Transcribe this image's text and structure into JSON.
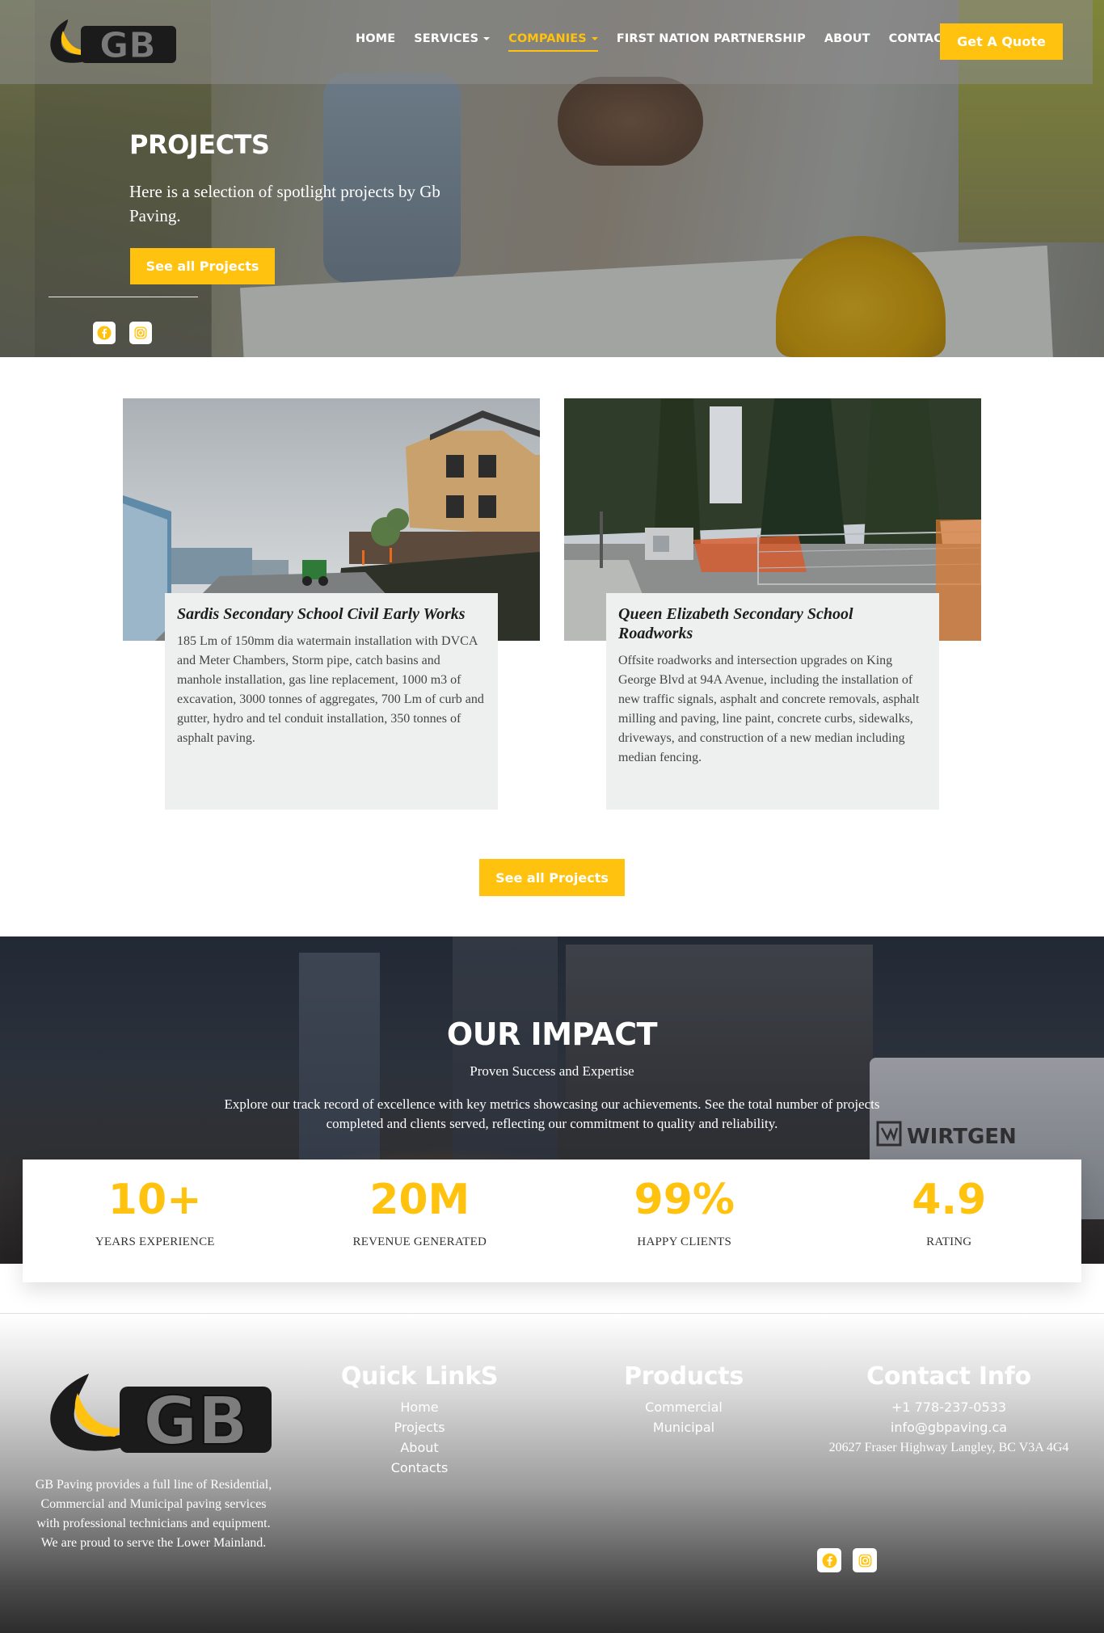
{
  "brand": {
    "logo_text": "GB",
    "accent": "#ffc20e"
  },
  "nav": {
    "items": [
      {
        "label": "HOME"
      },
      {
        "label": "SERVICES"
      },
      {
        "label": "COMPANIES"
      },
      {
        "label": "FIRST NATION PARTNERSHIP"
      },
      {
        "label": "ABOUT"
      },
      {
        "label": "CONTACT"
      }
    ],
    "cta": "Get A Quote"
  },
  "hero": {
    "title": "PROJECTS",
    "subtitle": "Here is a selection of spotlight projects by Gb Paving.",
    "button": "See all Projects"
  },
  "social": {
    "icons": [
      "facebook-icon",
      "instagram-icon"
    ]
  },
  "projects": [
    {
      "title": "Sardis Secondary School Civil Early Works",
      "description": "185 Lm of 150mm dia watermain installation with DVCA and Meter Chambers, Storm pipe, catch basins and manhole installation, gas line replacement, 1000 m3 of excavation, 3000 tonnes of aggregates, 700 Lm of curb and gutter, hydro and tel conduit installation, 350 tonnes of asphalt paving."
    },
    {
      "title": "Queen Elizabeth Secondary School Roadworks",
      "description": "Offsite roadworks and intersection upgrades on King George Blvd at 94A Avenue, including the installation of new traffic signals, asphalt and concrete removals, asphalt milling and paving, line paint, concrete curbs, sidewalks, driveways, and construction of a new median including median fencing."
    }
  ],
  "projects_button": "See all Projects",
  "impact": {
    "title": "OUR IMPACT",
    "subtitle": "Proven Success and Expertise",
    "description": "Explore our track record of excellence with key metrics showcasing our achievements. See the total number of projects completed and clients served, reflecting our commitment to quality and reliability.",
    "truck_text": "WIRTGEN",
    "stats": [
      {
        "value": "10+",
        "label": "YEARS EXPERIENCE"
      },
      {
        "value": "20M",
        "label": "REVENUE GENERATED"
      },
      {
        "value": "99%",
        "label": "HAPPY CLIENTS"
      },
      {
        "value": "4.9",
        "label": "RATING"
      }
    ]
  },
  "footer": {
    "about": "GB Paving provides a full line of Residential, Commercial and Municipal paving services with professional technicians and equipment. We are proud to serve the Lower Mainland.",
    "quick_links": {
      "heading": "Quick LinkS",
      "items": [
        "Home",
        "Projects",
        "About",
        "Contacts"
      ]
    },
    "products": {
      "heading": "Products",
      "items": [
        "Commercial",
        "Municipal"
      ]
    },
    "contact": {
      "heading": "Contact Info",
      "phone": "+1 778-237-0533",
      "email": "info@gbpaving.ca",
      "address": "20627 Fraser Highway Langley, BC V3A 4G4"
    }
  }
}
